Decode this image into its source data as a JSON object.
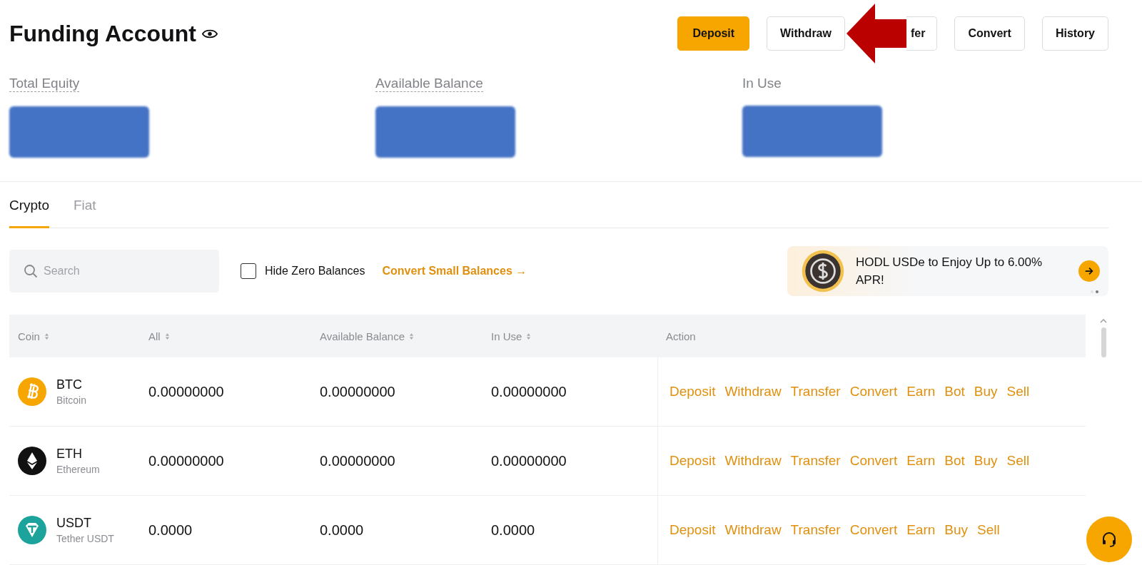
{
  "header": {
    "title": "Funding Account",
    "buttons": [
      {
        "label": "Deposit",
        "kind": "primary"
      },
      {
        "label": "Withdraw",
        "kind": "plain"
      },
      {
        "label": "fer",
        "kind": "covered"
      },
      {
        "label": "Convert",
        "kind": "plain"
      },
      {
        "label": "History",
        "kind": "plain"
      }
    ]
  },
  "summary": [
    {
      "label": "Total Equity",
      "dotted": true,
      "redacted": true
    },
    {
      "label": "Available Balance",
      "dotted": true,
      "redacted": true
    },
    {
      "label": "In Use",
      "dotted": false,
      "redacted": true
    }
  ],
  "tabs": [
    {
      "label": "Crypto",
      "selected": true
    },
    {
      "label": "Fiat",
      "selected": false
    }
  ],
  "search": {
    "placeholder": "Search"
  },
  "hide_zero": {
    "label": "Hide Zero Balances",
    "checked": false
  },
  "convert_link": {
    "label": "Convert Small Balances →"
  },
  "banner": {
    "text": "HODL USDe to Enjoy Up to 6.00% APR!",
    "dots": [
      {
        "selected": false
      },
      {
        "selected": true
      }
    ]
  },
  "table": {
    "columns": [
      {
        "label": "Coin",
        "sortable": true
      },
      {
        "label": "All",
        "sortable": true
      },
      {
        "label": "Available Balance",
        "sortable": true
      },
      {
        "label": "In Use",
        "sortable": true
      },
      {
        "label": "Action",
        "sortable": false
      }
    ],
    "rows": [
      {
        "symbol": "BTC",
        "name": "Bitcoin",
        "kind": "bitcoin",
        "all": "0.00000000",
        "available": "0.00000000",
        "in_use": "0.00000000",
        "actions": [
          "Deposit",
          "Withdraw",
          "Transfer",
          "Convert",
          "Earn",
          "Bot",
          "Buy",
          "Sell"
        ]
      },
      {
        "symbol": "ETH",
        "name": "Ethereum",
        "kind": "ether",
        "all": "0.00000000",
        "available": "0.00000000",
        "in_use": "0.00000000",
        "actions": [
          "Deposit",
          "Withdraw",
          "Transfer",
          "Convert",
          "Earn",
          "Bot",
          "Buy",
          "Sell"
        ]
      },
      {
        "symbol": "USDT",
        "name": "Tether USDT",
        "kind": "tether",
        "all": "0.0000",
        "available": "0.0000",
        "in_use": "0.0000",
        "actions": [
          "Deposit",
          "Withdraw",
          "Transfer",
          "Convert",
          "Earn",
          "Buy",
          "Sell"
        ]
      }
    ]
  }
}
